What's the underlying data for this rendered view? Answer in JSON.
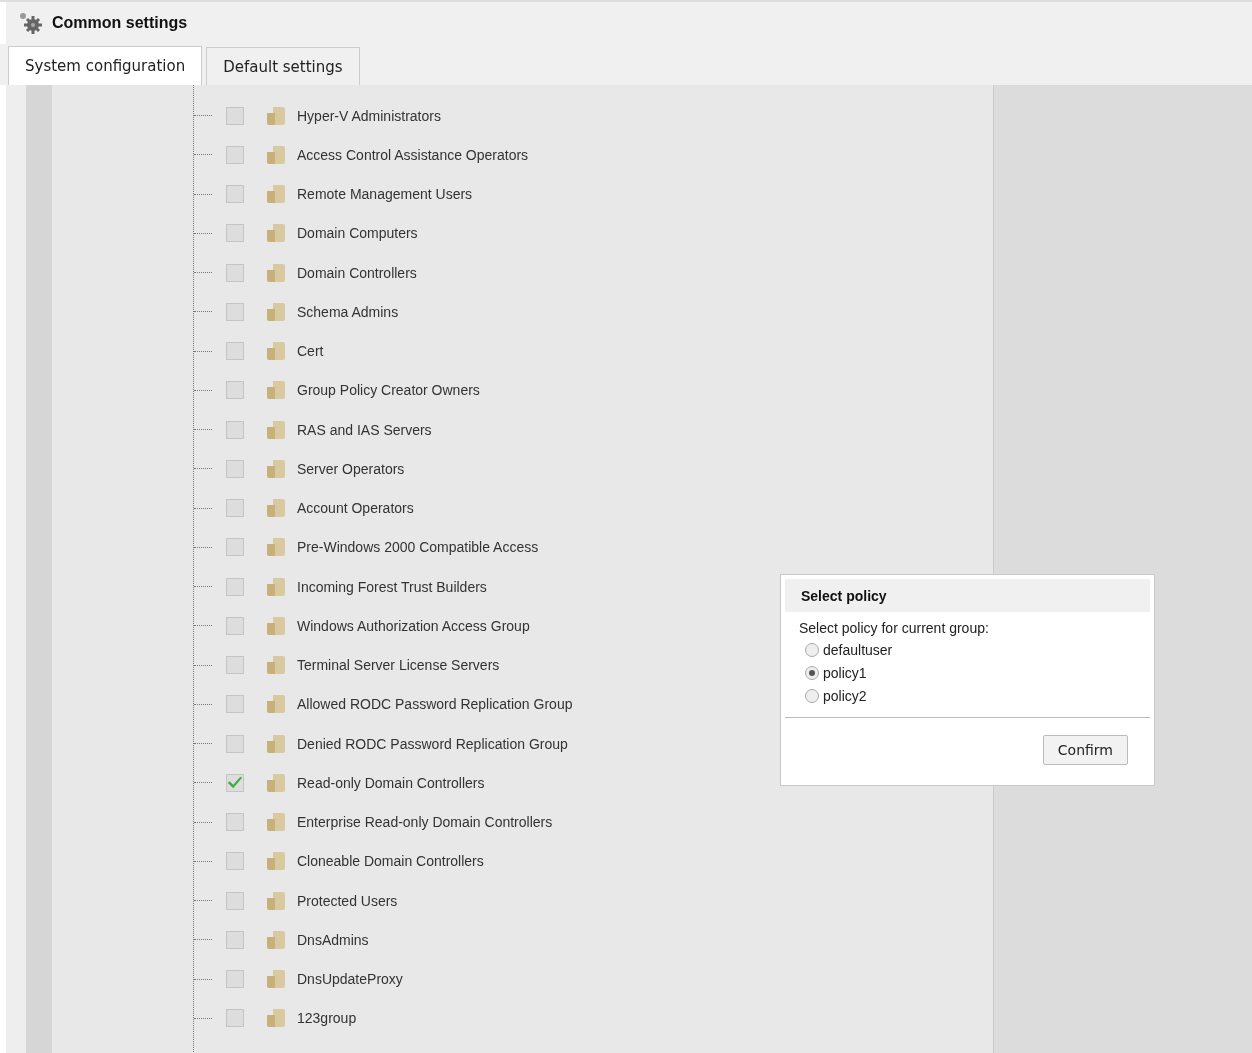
{
  "header": {
    "title": "Common settings"
  },
  "tabs": [
    {
      "label": "System configuration",
      "selected": true
    },
    {
      "label": "Default settings",
      "selected": false
    }
  ],
  "groups": [
    {
      "name": "Hyper-V Administrators",
      "checked": false
    },
    {
      "name": "Access Control Assistance Operators",
      "checked": false
    },
    {
      "name": "Remote Management Users",
      "checked": false
    },
    {
      "name": "Domain Computers",
      "checked": false
    },
    {
      "name": "Domain Controllers",
      "checked": false
    },
    {
      "name": "Schema Admins",
      "checked": false
    },
    {
      "name": "Cert",
      "checked": false
    },
    {
      "name": "Group Policy Creator Owners",
      "checked": false
    },
    {
      "name": "RAS and IAS Servers",
      "checked": false
    },
    {
      "name": "Server Operators",
      "checked": false
    },
    {
      "name": "Account Operators",
      "checked": false
    },
    {
      "name": "Pre-Windows 2000 Compatible Access",
      "checked": false
    },
    {
      "name": "Incoming Forest Trust Builders",
      "checked": false
    },
    {
      "name": "Windows Authorization Access Group",
      "checked": false
    },
    {
      "name": "Terminal Server License Servers",
      "checked": false
    },
    {
      "name": "Allowed RODC Password Replication Group",
      "checked": false
    },
    {
      "name": "Denied RODC Password Replication Group",
      "checked": false
    },
    {
      "name": "Read-only Domain Controllers",
      "checked": true
    },
    {
      "name": "Enterprise Read-only Domain Controllers",
      "checked": false
    },
    {
      "name": "Cloneable Domain Controllers",
      "checked": false
    },
    {
      "name": "Protected Users",
      "checked": false
    },
    {
      "name": "DnsAdmins",
      "checked": false
    },
    {
      "name": "DnsUpdateProxy",
      "checked": false
    },
    {
      "name": "123group",
      "checked": false
    }
  ],
  "dialog": {
    "title": "Select policy",
    "prompt": "Select policy for current group:",
    "options": [
      {
        "label": "defaultuser",
        "selected": false
      },
      {
        "label": "policy1",
        "selected": true
      },
      {
        "label": "policy2",
        "selected": false
      }
    ],
    "confirm": "Confirm"
  }
}
